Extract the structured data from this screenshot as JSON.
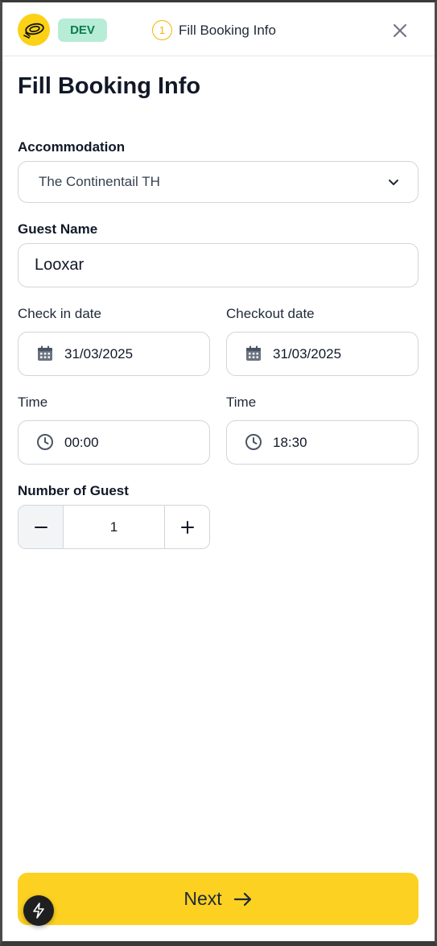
{
  "header": {
    "env_badge": "DEV",
    "step_number": "1",
    "step_label": "Fill Booking Info"
  },
  "page": {
    "title": "Fill Booking Info"
  },
  "form": {
    "accommodation": {
      "label": "Accommodation",
      "value": "The Continentail TH"
    },
    "guest_name": {
      "label": "Guest Name",
      "value": "Looxar"
    },
    "check_in": {
      "label": "Check in date",
      "value": "31/03/2025"
    },
    "checkout": {
      "label": "Checkout date",
      "value": "31/03/2025"
    },
    "check_in_time": {
      "label": "Time",
      "value": "00:00"
    },
    "checkout_time": {
      "label": "Time",
      "value": "18:30"
    },
    "guests": {
      "label": "Number of Guest",
      "value": "1"
    }
  },
  "footer": {
    "next_label": "Next"
  },
  "icons": {
    "logo": "logo-icon",
    "close": "close-icon",
    "chevron": "chevron-down-icon",
    "calendar": "calendar-icon",
    "clock": "clock-icon",
    "minus": "minus-icon",
    "plus": "plus-icon",
    "arrow": "arrow-right-icon",
    "bolt": "lightning-icon"
  },
  "colors": {
    "primary": "#fcd121",
    "badge_bg": "#b7ecd6",
    "badge_text": "#0e7a52",
    "step_accent": "#f4b400"
  }
}
